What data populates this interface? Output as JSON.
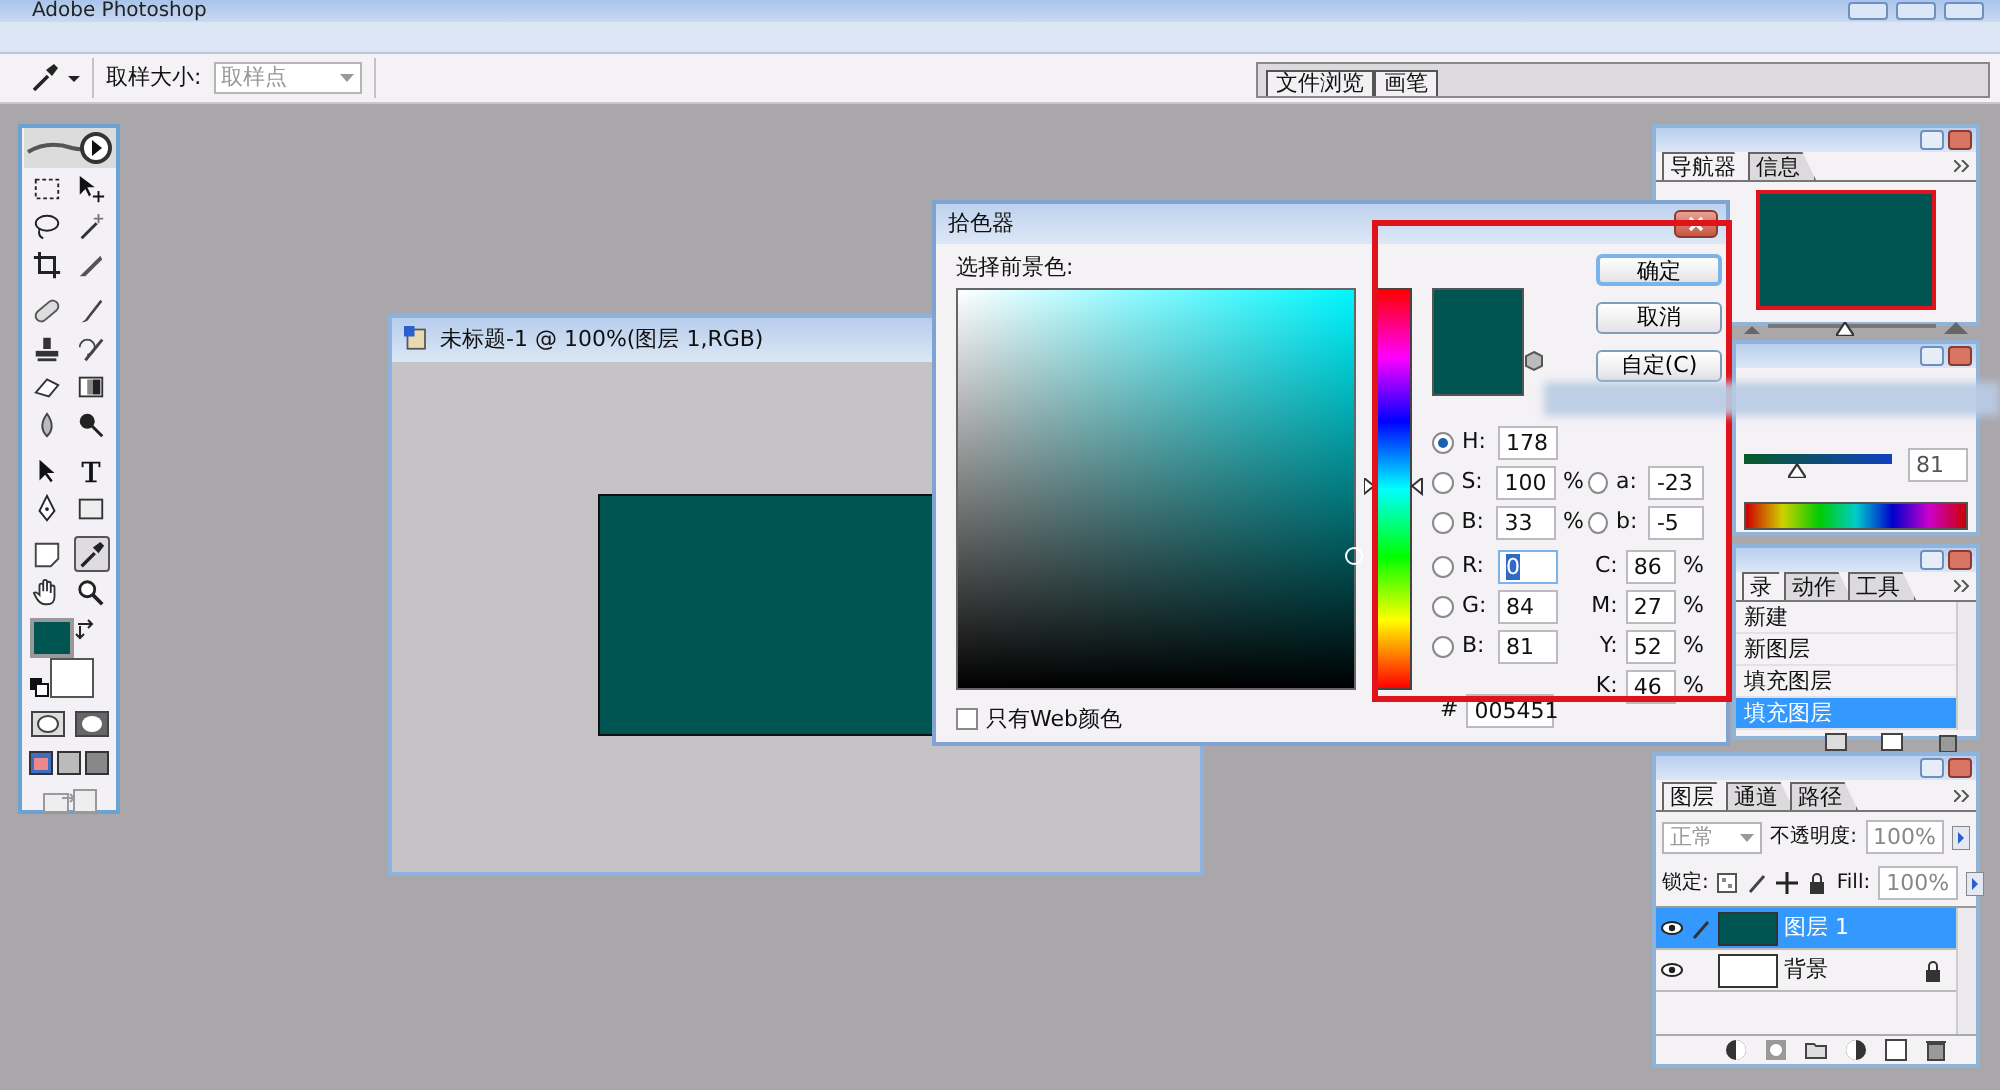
{
  "app": {
    "title": "Adobe Photoshop"
  },
  "options_bar": {
    "sample_size_label": "取样大小:",
    "sample_size_value": "取样点",
    "well_tabs": [
      {
        "label": "文件浏览"
      },
      {
        "label": "画笔"
      }
    ]
  },
  "tools": [
    {
      "kind": "marquee",
      "selected": false
    },
    {
      "kind": "move",
      "selected": false
    },
    {
      "kind": "lasso",
      "selected": false
    },
    {
      "kind": "wand",
      "selected": false
    },
    {
      "kind": "crop",
      "selected": false
    },
    {
      "kind": "slice",
      "selected": false
    },
    {
      "kind": "healing",
      "selected": false
    },
    {
      "kind": "brush",
      "selected": false
    },
    {
      "kind": "stamp",
      "selected": false
    },
    {
      "kind": "history_brush",
      "selected": false
    },
    {
      "kind": "eraser",
      "selected": false
    },
    {
      "kind": "gradient",
      "selected": false
    },
    {
      "kind": "blur",
      "selected": false
    },
    {
      "kind": "dodge",
      "selected": false
    },
    {
      "kind": "path_select",
      "selected": false
    },
    {
      "kind": "type",
      "selected": false
    },
    {
      "kind": "pen",
      "selected": false
    },
    {
      "kind": "shape",
      "selected": false
    },
    {
      "kind": "notes",
      "selected": false
    },
    {
      "kind": "eyedropper",
      "selected": true
    },
    {
      "kind": "hand",
      "selected": false
    },
    {
      "kind": "zoom",
      "selected": false
    }
  ],
  "foreground": {
    "color": "#005451"
  },
  "document": {
    "title": "未标题-1 @ 100%(图层 1,RGB)"
  },
  "color_picker": {
    "title": "拾色器",
    "prompt": "选择前景色:",
    "hue_slider": {
      "level": 0.494
    },
    "buttons": [
      {
        "label": "确定",
        "kind": "default"
      },
      {
        "label": "取消",
        "kind": "normal"
      },
      {
        "label": "自定(C)",
        "kind": "normal"
      }
    ],
    "hsb": [
      {
        "label": "H:",
        "value": "178",
        "selected": true
      },
      {
        "label": "S:",
        "value": "100",
        "unit": "%",
        "selected": false
      },
      {
        "label": "B:",
        "value": "33",
        "unit": "%",
        "selected": false
      }
    ],
    "lab": [
      {
        "label": "a:",
        "value": "-23",
        "selected": false
      },
      {
        "label": "b:",
        "value": "-5",
        "selected": false
      }
    ],
    "rgb": [
      {
        "label": "R:",
        "value": "0",
        "selected": false,
        "focused": true
      },
      {
        "label": "G:",
        "value": "84",
        "selected": false,
        "focused": false
      },
      {
        "label": "B:",
        "value": "81",
        "selected": false,
        "focused": false
      }
    ],
    "cmyk": [
      {
        "label": "C:",
        "value": "86",
        "unit": "%"
      },
      {
        "label": "M:",
        "value": "27",
        "unit": "%"
      },
      {
        "label": "Y:",
        "value": "52",
        "unit": "%"
      },
      {
        "label": "K:",
        "value": "46",
        "unit": "%"
      }
    ],
    "hex_label": "#",
    "hex": "005451",
    "web_only": {
      "label": "只有Web颜色",
      "checked": false
    }
  },
  "navigator": {
    "tabs": [
      {
        "label": "导航器",
        "selected": true
      },
      {
        "label": "信息",
        "selected": false
      }
    ],
    "zoom_slider": {
      "level": 0.45
    }
  },
  "color_panel": {
    "slider": {
      "level": 0.35
    },
    "value": "81"
  },
  "history": {
    "tabs": [
      {
        "label": "录",
        "selected": true
      },
      {
        "label": "动作",
        "selected": false
      },
      {
        "label": "工具",
        "selected": false
      }
    ],
    "items": [
      {
        "label": "新建",
        "selected": false
      },
      {
        "label": "新图层",
        "selected": false
      },
      {
        "label": "填充图层",
        "selected": false
      },
      {
        "label": "填充图层",
        "selected": true
      }
    ]
  },
  "layers": {
    "tabs": [
      {
        "label": "图层",
        "selected": true
      },
      {
        "label": "通道",
        "selected": false
      },
      {
        "label": "路径",
        "selected": false
      }
    ],
    "blend_mode": "正常",
    "opacity_label": "不透明度:",
    "opacity": "100%",
    "lock_label": "锁定:",
    "fill_label": "Fill:",
    "fill": "100%",
    "items": [
      {
        "name": "图层 1",
        "selected": true,
        "visible": true,
        "linked": true,
        "locked": false,
        "kind": "color"
      },
      {
        "name": "背景",
        "selected": false,
        "visible": true,
        "linked": false,
        "locked": true,
        "kind": "white"
      }
    ]
  }
}
